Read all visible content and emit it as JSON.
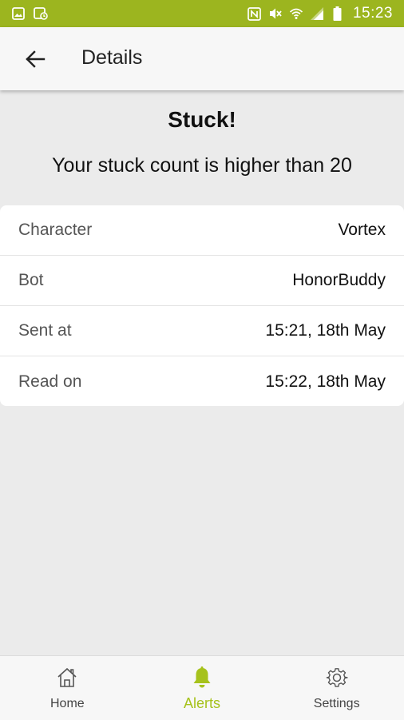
{
  "status_bar": {
    "time": "15:23",
    "icons": [
      "image-icon",
      "gallery-settings-icon",
      "nfc-icon",
      "mute-icon",
      "wifi-icon",
      "signal-icon",
      "battery-icon"
    ],
    "color": "#9cb51f"
  },
  "app_bar": {
    "title": "Details",
    "back_icon": "arrow-back-icon"
  },
  "alert": {
    "title": "Stuck!",
    "message": "Your stuck count is higher than 20"
  },
  "details": [
    {
      "label": "Character",
      "value": "Vortex"
    },
    {
      "label": "Bot",
      "value": "HonorBuddy"
    },
    {
      "label": "Sent at",
      "value": "15:21, 18th May"
    },
    {
      "label": "Read on",
      "value": "15:22, 18th May"
    }
  ],
  "bottom_nav": {
    "active": "Alerts",
    "accent": "#a6c21c",
    "items": [
      {
        "label": "Home",
        "icon": "home-icon"
      },
      {
        "label": "Alerts",
        "icon": "bell-icon"
      },
      {
        "label": "Settings",
        "icon": "gear-icon"
      }
    ]
  }
}
